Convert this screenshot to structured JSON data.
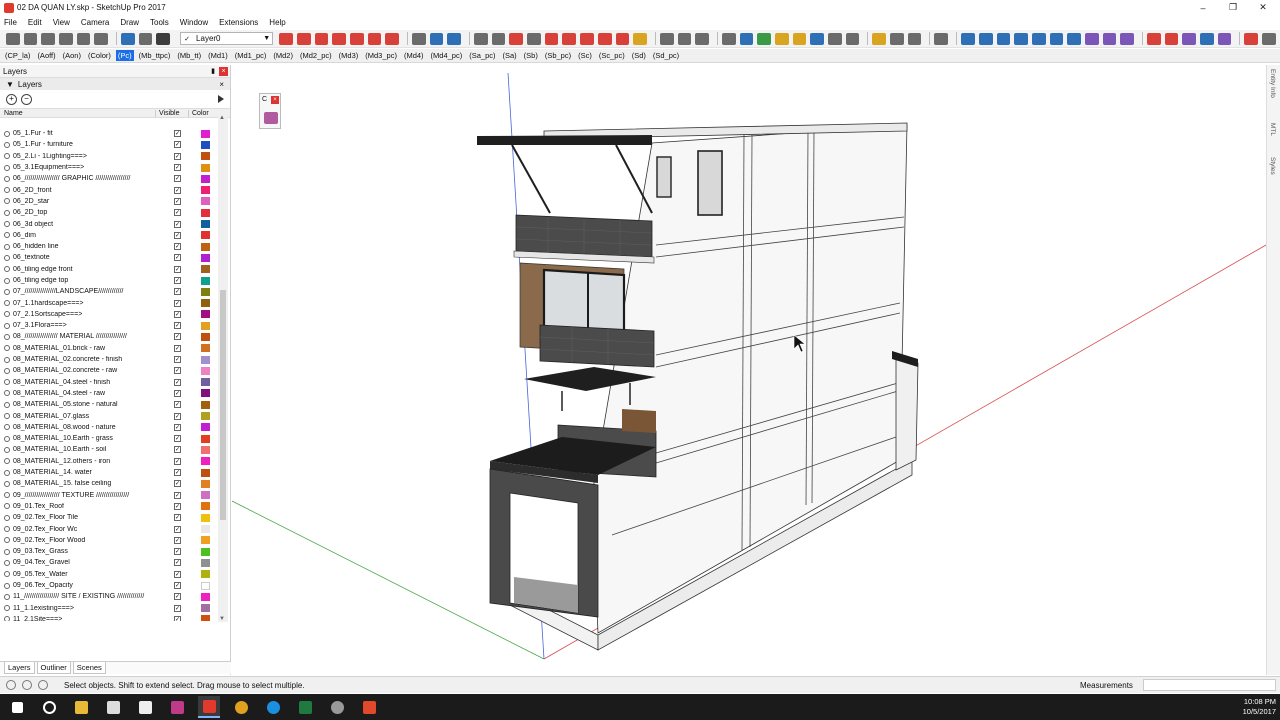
{
  "window": {
    "title": "02 DA QUAN LY.skp - SketchUp Pro 2017"
  },
  "menu": [
    "File",
    "Edit",
    "View",
    "Camera",
    "Draw",
    "Tools",
    "Window",
    "Extensions",
    "Help"
  ],
  "toolbar": {
    "layer_value": "Layer0"
  },
  "scene_tabs": [
    "(CP_la)",
    "(Aoff)",
    "(Aon)",
    "(Color)",
    "(Pc)",
    "(Mb_ttpc)",
    "(Mb_tt)",
    "(Md1)",
    "(Md1_pc)",
    "(Md2)",
    "(Md2_pc)",
    "(Md3)",
    "(Md3_pc)",
    "(Md4)",
    "(Md4_pc)",
    "(Sa_pc)",
    "(Sa)",
    "(Sb)",
    "(Sb_pc)",
    "(Sc)",
    "(Sc_pc)",
    "(Sd)",
    "(Sd_pc)"
  ],
  "active_scene": "(Pc)",
  "panel": {
    "tray_title": "Layers",
    "section_title": "Layers",
    "columns": {
      "name": "Name",
      "visible": "Visible",
      "color": "Color"
    },
    "tabs": [
      "Layers",
      "Outliner",
      "Scenes"
    ]
  },
  "layers": [
    {
      "name": "05_1.Fur - fit",
      "color": "#e020d0"
    },
    {
      "name": "05_1.Fur - furniture",
      "color": "#2050c0"
    },
    {
      "name": "05_2.Li - 1Lighting===>",
      "color": "#c05010"
    },
    {
      "name": "05_3.1Equipment===>",
      "color": "#e09010"
    },
    {
      "name": "06_////////////////// GRAPHIC //////////////////",
      "color": "#c020d0"
    },
    {
      "name": "06_2D_front",
      "color": "#f02070"
    },
    {
      "name": "06_2D_star",
      "color": "#e060c0"
    },
    {
      "name": "06_2D_top",
      "color": "#e03040"
    },
    {
      "name": "06_3d object",
      "color": "#1060a0"
    },
    {
      "name": "06_dim",
      "color": "#e03030"
    },
    {
      "name": "06_hidden line",
      "color": "#c06010"
    },
    {
      "name": "06_textnote",
      "color": "#b020d0"
    },
    {
      "name": "06_tiling edge front",
      "color": "#a06020"
    },
    {
      "name": "06_tiling edge top",
      "color": "#10a090"
    },
    {
      "name": "07_////////////////LANDSCAPE/////////////",
      "color": "#808010"
    },
    {
      "name": "07_1.1hardscape===>",
      "color": "#906010"
    },
    {
      "name": "07_2.1Sortscape===>",
      "color": "#a01080"
    },
    {
      "name": "07_3.1Flora===>",
      "color": "#e0a020"
    },
    {
      "name": "08_///////////////// MATERIAL ////////////////",
      "color": "#c05010"
    },
    {
      "name": "08_MATERIAL_01.brick - raw",
      "color": "#d07020"
    },
    {
      "name": "08_MATERIAL_02.concrete - finish",
      "color": "#a090d0"
    },
    {
      "name": "08_MATERIAL_02.concrete - raw",
      "color": "#f080c0"
    },
    {
      "name": "08_MATERIAL_04.steel - finish",
      "color": "#7060a0"
    },
    {
      "name": "08_MATERIAL_04.steel - raw",
      "color": "#801080"
    },
    {
      "name": "08_MATERIAL_05.stone - natural",
      "color": "#a06010"
    },
    {
      "name": "08_MATERIAL_07.glass",
      "color": "#b0a020"
    },
    {
      "name": "08_MATERIAL_08.wood - nature",
      "color": "#c020d0"
    },
    {
      "name": "08_MATERIAL_10.Earth - grass",
      "color": "#e04020"
    },
    {
      "name": "08_MATERIAL_10.Earth - soil",
      "color": "#f07070"
    },
    {
      "name": "08_MATERIAL_12.others - iron",
      "color": "#f020c0"
    },
    {
      "name": "08_MATERIAL_14. water",
      "color": "#c05010"
    },
    {
      "name": "08_MATERIAL_15. false ceiling",
      "color": "#e08020"
    },
    {
      "name": "09_////////////////// TEXTURE /////////////////",
      "color": "#d070c0"
    },
    {
      "name": "09_01.Tex_Roof",
      "color": "#e07010"
    },
    {
      "name": "09_02.Tex_Floor Tile",
      "color": "#f0c010"
    },
    {
      "name": "09_02.Tex_Floor Wc",
      "color": "#e8e8e8"
    },
    {
      "name": "09_02.Tex_Floor Wood",
      "color": "#f0a020"
    },
    {
      "name": "09_03.Tex_Grass",
      "color": "#50c020"
    },
    {
      "name": "09_04.Tex_Gravel",
      "color": "#909090"
    },
    {
      "name": "09_05.Tex_Water",
      "color": "#b0b010"
    },
    {
      "name": "09_06.Tex_Opacity",
      "color": "#ffffff"
    },
    {
      "name": "11_////////////////// SITE / EXISTING //////////////",
      "color": "#f020c0"
    },
    {
      "name": "11_1.1existing===>",
      "color": "#a070a0"
    },
    {
      "name": "11_2.1Site===>",
      "color": "#d05010"
    }
  ],
  "tray_labels": [
    "Entity Info",
    "MTL",
    "Styles"
  ],
  "status": {
    "hint": "Select objects. Shift to extend select. Drag mouse to select multiple.",
    "measurements_label": "Measurements"
  },
  "clock": {
    "time": "10:08 PM",
    "date": "10/5/2017"
  },
  "colors": {
    "active_tab": "#1c6ee6",
    "taskbar": "#1b1b1b"
  }
}
